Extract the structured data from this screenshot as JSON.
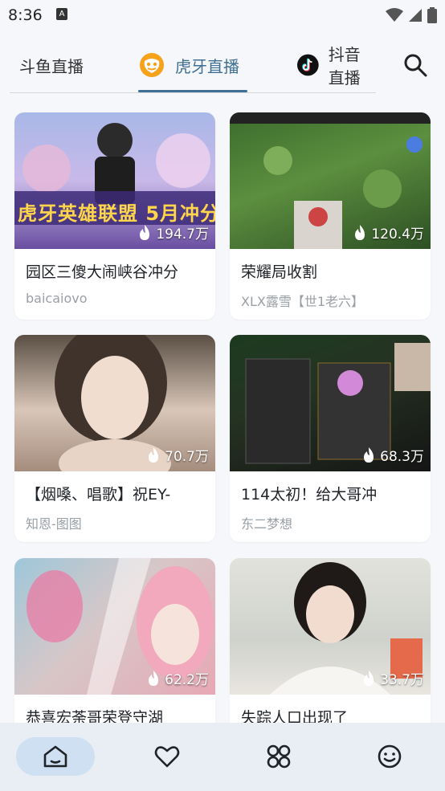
{
  "status": {
    "time": "8:36",
    "a_icon_glyph": "A"
  },
  "tabs": [
    {
      "label": "斗鱼直播"
    },
    {
      "label": "虎牙直播",
      "active": true
    },
    {
      "label": "抖音直播"
    }
  ],
  "colors": {
    "accent": "#3f6f93",
    "background": "#f6f7fb",
    "nav_bg": "#e9edf4",
    "nav_active": "#cfe0f3"
  },
  "cards": [
    {
      "title": "园区三傻大闹峡谷冲分",
      "author": "baicaiovo",
      "views": "194.7万",
      "thumb_text": "虎牙英雄联盟 5月冲分赛"
    },
    {
      "title": "荣耀局收割",
      "author": "XLX露雪【世1老六】",
      "views": "120.4万"
    },
    {
      "title": "【烟嗓、唱歌】祝EY-",
      "author": "知恩-图图",
      "views": "70.7万"
    },
    {
      "title": "114太初！给大哥冲",
      "author": "东二梦想",
      "views": "68.3万"
    },
    {
      "title": "恭喜宏荼哥荣登守湖",
      "author": "",
      "views": "62.2万"
    },
    {
      "title": "失踪人口出现了",
      "author": "",
      "views": "33.7万"
    }
  ],
  "nav": [
    {
      "icon": "home-icon"
    },
    {
      "icon": "heart-icon"
    },
    {
      "icon": "category-icon"
    },
    {
      "icon": "smile-icon"
    }
  ]
}
